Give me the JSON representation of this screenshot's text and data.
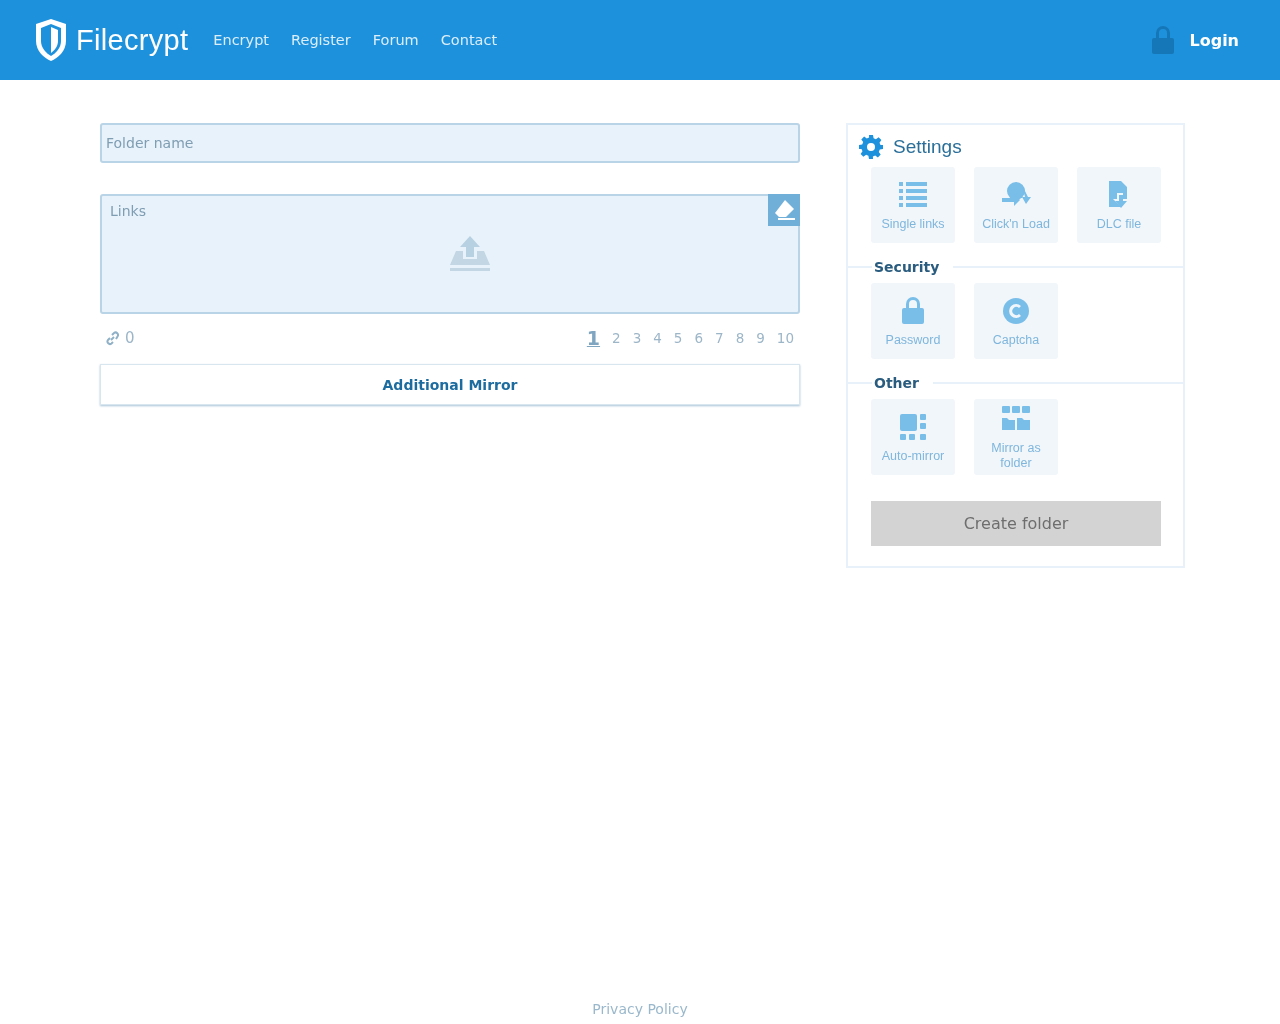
{
  "header": {
    "brand": "Filecrypt",
    "nav": [
      "Encrypt",
      "Register",
      "Forum",
      "Contact"
    ],
    "login": "Login"
  },
  "form": {
    "folder_name": {
      "placeholder": "Folder name"
    },
    "links": {
      "placeholder": "Links"
    },
    "link_count": "0",
    "mirror_pages": [
      {
        "label": "1",
        "selected": true
      },
      {
        "label": "2",
        "selected": false
      },
      {
        "label": "3",
        "selected": false
      },
      {
        "label": "4",
        "selected": false
      },
      {
        "label": "5",
        "selected": false
      },
      {
        "label": "6",
        "selected": false
      },
      {
        "label": "7",
        "selected": false
      },
      {
        "label": "8",
        "selected": false
      },
      {
        "label": "9",
        "selected": false
      },
      {
        "label": "10",
        "selected": false
      }
    ],
    "additional_mirror": "Additional Mirror"
  },
  "settings": {
    "title": "Settings",
    "sections": [
      {
        "options": [
          {
            "kind": "list",
            "label": "Single links"
          },
          {
            "kind": "clicknload",
            "label": "Click'n Load"
          },
          {
            "kind": "dlc",
            "label": "DLC file"
          }
        ]
      },
      {
        "heading": "Security",
        "options": [
          {
            "kind": "lock",
            "label": "Password"
          },
          {
            "kind": "captcha",
            "label": "Captcha"
          }
        ]
      },
      {
        "heading": "Other",
        "options": [
          {
            "kind": "automirror",
            "label": "Auto-mirror"
          },
          {
            "kind": "mirrorfolder",
            "label": "Mirror as folder"
          }
        ]
      }
    ],
    "create_button": {
      "label": "Create folder",
      "disabled": true
    }
  },
  "footer": {
    "link": "Privacy Policy"
  }
}
